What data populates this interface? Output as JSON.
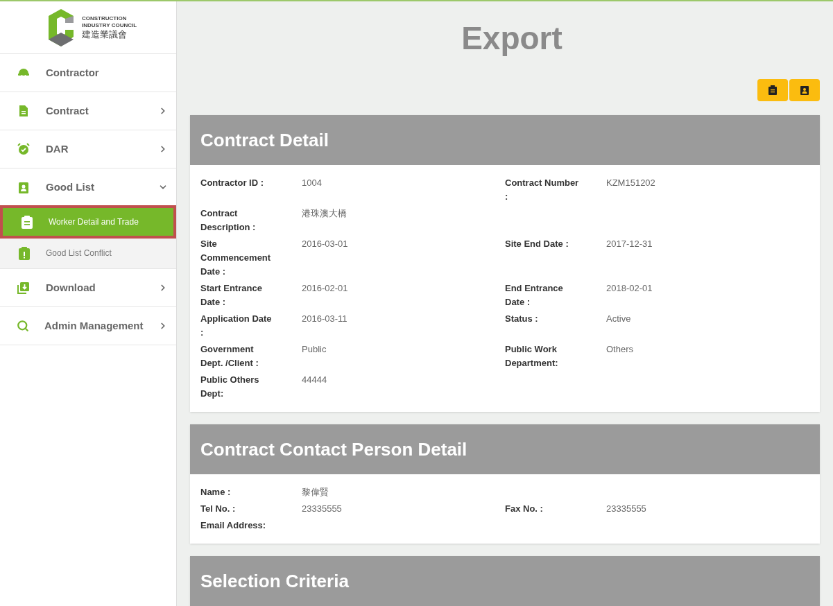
{
  "logo": {
    "lines": [
      "CONSTRUCTION",
      "INDUSTRY COUNCIL"
    ],
    "chinese": "建造業議會"
  },
  "sidebar": {
    "items": [
      {
        "label": "Contractor",
        "kind": "link",
        "selected": false
      },
      {
        "label": "Contract",
        "kind": "group",
        "expanded": false,
        "selected": false
      },
      {
        "label": "DAR",
        "kind": "group",
        "expanded": false,
        "selected": false
      },
      {
        "label": "Good List",
        "kind": "group",
        "expanded": true,
        "selected": false,
        "children": [
          {
            "label": "Worker Detail and Trade",
            "selected": true
          },
          {
            "label": "Good List Conflict",
            "selected": false
          }
        ]
      },
      {
        "label": "Download",
        "kind": "group",
        "expanded": false,
        "selected": false
      },
      {
        "label": "Admin Management",
        "kind": "group",
        "expanded": false,
        "selected": false
      }
    ]
  },
  "page_title": "Export",
  "sections": [
    {
      "title": "Contract Detail",
      "rows": [
        [
          {
            "label": "Contractor ID :",
            "value": "1004"
          },
          {
            "label": "Contract Number :",
            "value": "KZM151202"
          }
        ],
        [
          {
            "label": "Contract Description :",
            "value": "港珠澳大橋"
          }
        ],
        [
          {
            "label": "Site Commencement Date :",
            "value": "2016-03-01"
          },
          {
            "label": "Site End Date :",
            "value": "2017-12-31"
          }
        ],
        [
          {
            "label": "Start Entrance Date :",
            "value": "2016-02-01"
          },
          {
            "label": "End Entrance Date :",
            "value": "2018-02-01"
          }
        ],
        [
          {
            "label": "Application Date :",
            "value": "2016-03-11"
          },
          {
            "label": "Status :",
            "value": "Active"
          }
        ],
        [
          {
            "label": "Government Dept. /Client :",
            "value": "Public"
          },
          {
            "label": "Public Work Department:",
            "value": "Others"
          }
        ],
        [
          {
            "label": "Public Others Dept:",
            "value": "44444"
          }
        ]
      ]
    },
    {
      "title": "Contract Contact Person Detail",
      "rows": [
        [
          {
            "label": "Name :",
            "value": "黎偉賢"
          }
        ],
        [
          {
            "label": "Tel No. :",
            "value": "23335555"
          },
          {
            "label": "Fax No. :",
            "value": "23335555"
          }
        ],
        [
          {
            "label": "Email Address:"
          }
        ]
      ]
    },
    {
      "title": "Selection Criteria"
    }
  ]
}
